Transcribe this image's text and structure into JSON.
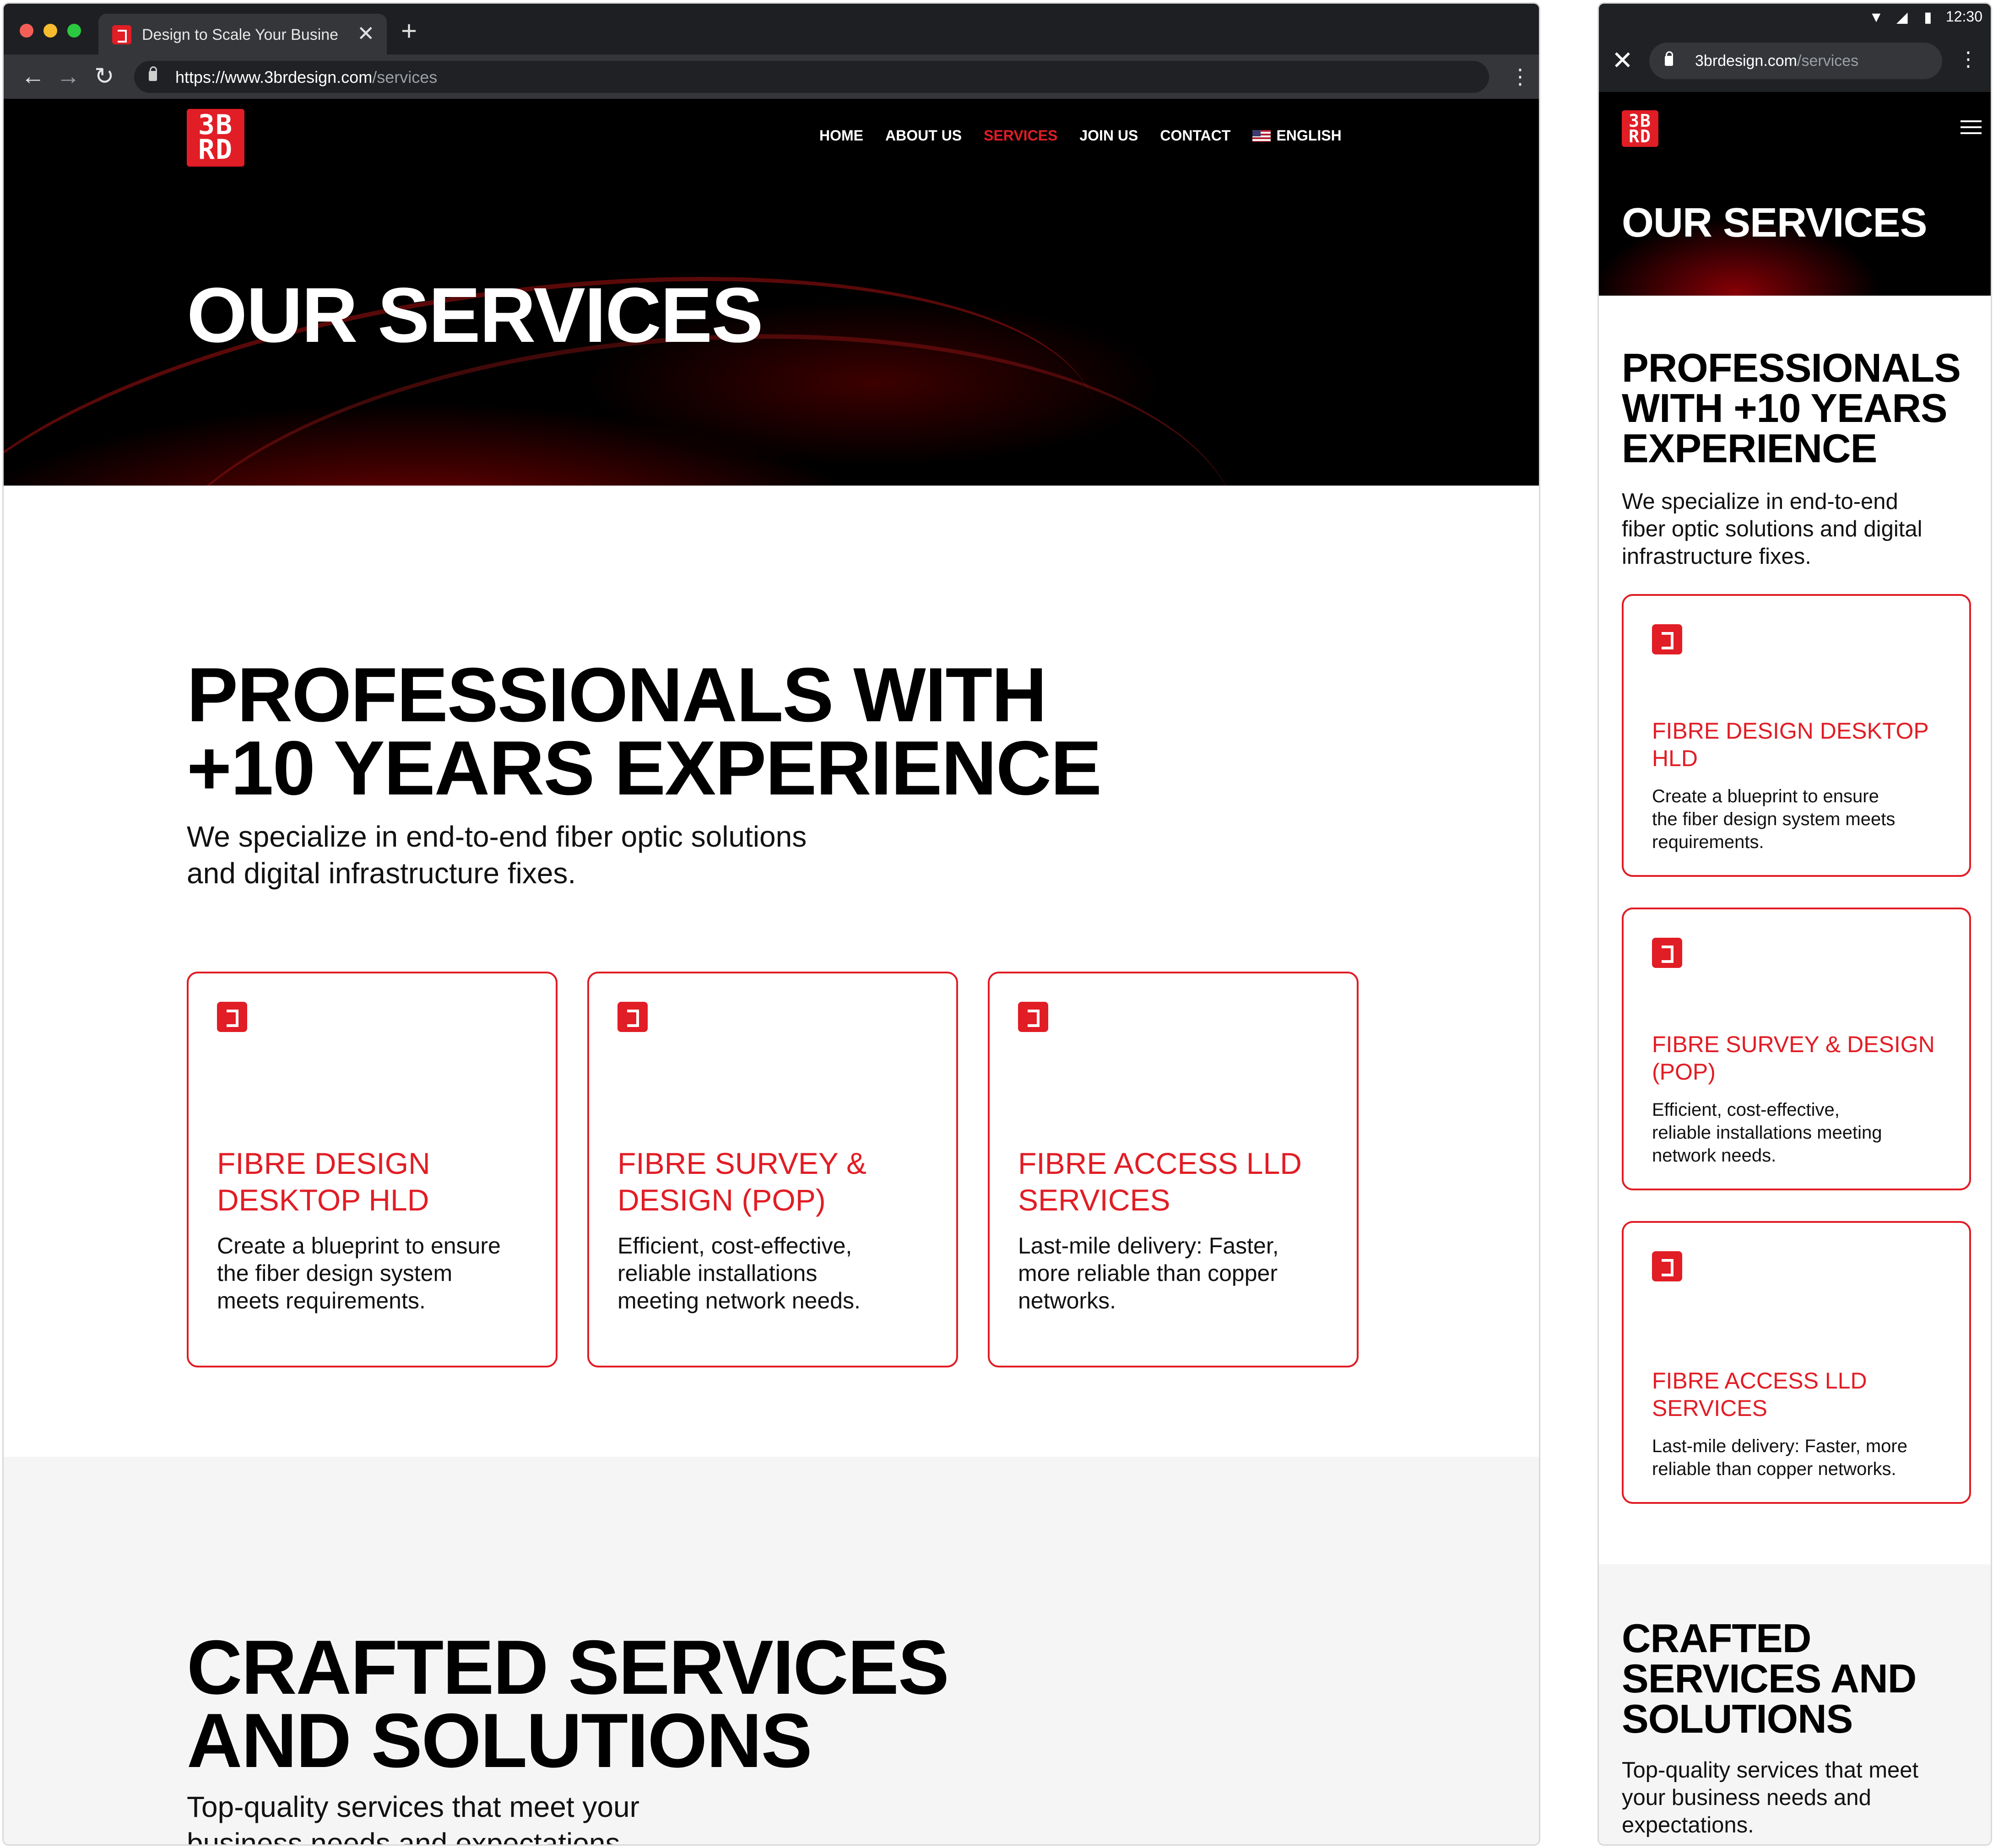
{
  "desktop": {
    "browser": {
      "tab_title": "Design to Scale Your Business",
      "tab_close": "✕",
      "new_tab": "+",
      "url_host": "https://www.3brdesign.com",
      "url_path": "/services",
      "back": "←",
      "forward": "→",
      "reload": "↻",
      "menu": "⋮"
    },
    "logo": {
      "line1": "3B",
      "line2": "RD"
    },
    "nav": {
      "items": [
        "HOME",
        "ABOUT US",
        "SERVICES",
        "JOIN US",
        "CONTACT"
      ],
      "active": "SERVICES",
      "language": "ENGLISH"
    },
    "hero_title": "OUR SERVICES",
    "section1": {
      "heading_line1": "PROFESSIONALS WITH",
      "heading_line2": "+10 YEARS EXPERIENCE",
      "lead_line1": "We specialize in end-to-end fiber optic solutions",
      "lead_line2": "and digital infrastructure fixes."
    },
    "cards": [
      {
        "title_line1": "FIBRE DESIGN",
        "title_line2": "DESKTOP HLD",
        "text_lines": [
          "Create a blueprint to ensure",
          "the fiber design system",
          "meets requirements."
        ]
      },
      {
        "title_line1": "FIBRE SURVEY &",
        "title_line2": "DESIGN (POP)",
        "text_lines": [
          "Efficient, cost-effective,",
          "reliable installations",
          "meeting network needs."
        ]
      },
      {
        "title_line1": "FIBRE ACCESS LLD",
        "title_line2": "SERVICES",
        "text_lines": [
          "Last-mile delivery: Faster,",
          "more reliable than copper",
          "networks."
        ]
      }
    ],
    "section2": {
      "heading_line1": "CRAFTED SERVICES",
      "heading_line2": "AND SOLUTIONS",
      "lead_line1": "Top-quality services that meet your",
      "lead_line2": "business needs and expectations."
    }
  },
  "mobile": {
    "status": {
      "time": "12:30",
      "wifi": "▼",
      "signal": "◢",
      "battery": "▮"
    },
    "browser": {
      "close": "✕",
      "url_host": "3brdesign.com",
      "url_path": "/services",
      "menu": "⋮"
    },
    "logo": {
      "line1": "3B",
      "line2": "RD"
    },
    "hero_title": "OUR SERVICES",
    "section1": {
      "heading_lines": [
        "PROFESSIONALS",
        "WITH +10 YEARS",
        "EXPERIENCE"
      ],
      "lead_lines": [
        "We specialize in end-to-end",
        "fiber optic solutions and digital",
        "infrastructure fixes."
      ]
    },
    "cards": [
      {
        "title_lines": [
          "FIBRE DESIGN DESKTOP",
          "HLD"
        ],
        "text_lines": [
          "Create a blueprint to ensure",
          "the fiber design system meets",
          "requirements."
        ]
      },
      {
        "title_lines": [
          "FIBRE SURVEY & DESIGN",
          "(POP)"
        ],
        "text_lines": [
          "Efficient, cost-effective,",
          "reliable installations meeting",
          "network needs."
        ]
      },
      {
        "title_lines": [
          "FIBRE ACCESS LLD",
          "SERVICES"
        ],
        "text_lines": [
          "Last-mile delivery: Faster, more",
          "reliable than copper networks."
        ]
      }
    ],
    "section2": {
      "heading_lines": [
        "CRAFTED",
        "SERVICES AND",
        "SOLUTIONS"
      ],
      "lead_lines": [
        "Top-quality services that meet",
        "your business needs and",
        "expectations."
      ]
    }
  },
  "colors": {
    "brand_red": "#e11d25",
    "hero_bg": "#000000",
    "section_gray": "#f5f5f5",
    "browser_chrome": "#35363a"
  }
}
